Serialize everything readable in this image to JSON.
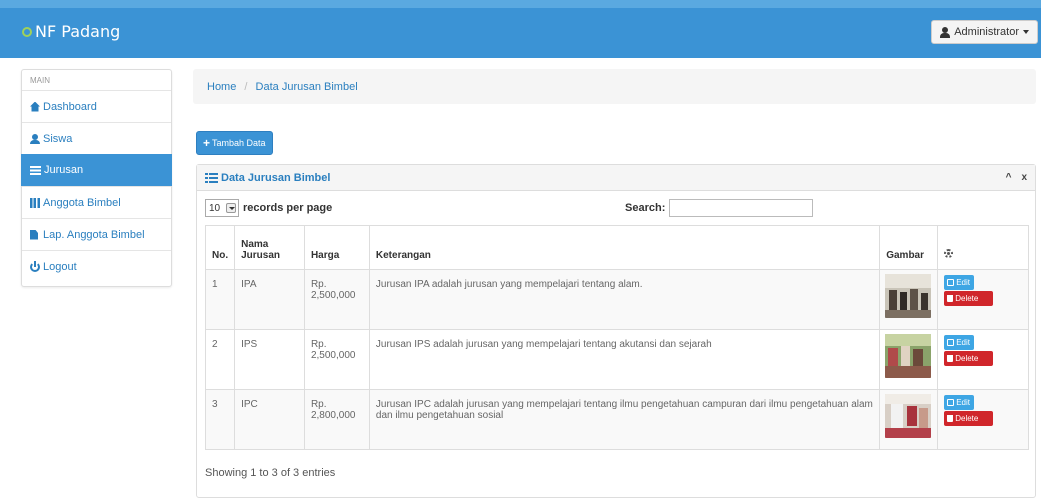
{
  "navbar": {
    "brand": "NF Padang",
    "user_label": "Administrator"
  },
  "sidebar": {
    "heading": "MAIN",
    "items": [
      {
        "label": "Dashboard",
        "icon": "home-icon"
      },
      {
        "label": "Siswa",
        "icon": "user-icon"
      },
      {
        "label": "Jurusan",
        "icon": "list-icon",
        "active": true
      },
      {
        "label": "Anggota Bimbel",
        "icon": "th-icon"
      },
      {
        "label": "Lap. Anggota Bimbel",
        "icon": "file-icon"
      },
      {
        "label": "Logout",
        "icon": "power-icon"
      }
    ]
  },
  "breadcrumb": {
    "home": "Home",
    "separator": "/",
    "current": "Data Jurusan Bimbel"
  },
  "add_button": "Tambah Data",
  "panel": {
    "title": "Data Jurusan Bimbel",
    "tools": [
      "^",
      "x"
    ]
  },
  "datatable": {
    "length_value": "10",
    "length_label": "records per page",
    "search_label": "Search:",
    "search_value": "",
    "columns": [
      "No.",
      "Nama Jurusan",
      "Harga",
      "Keterangan",
      "Gambar"
    ],
    "rows": [
      {
        "no": "1",
        "nama": "IPA",
        "harga": "Rp. 2,500,000",
        "keterangan": "Jurusan IPA adalah jurusan yang mempelajari tentang alam."
      },
      {
        "no": "2",
        "nama": "IPS",
        "harga": "Rp. 2,500,000",
        "keterangan": "Jurusan IPS adalah jurusan yang mempelajari tentang akutansi dan sejarah"
      },
      {
        "no": "3",
        "nama": "IPC",
        "harga": "Rp. 2,800,000",
        "keterangan": "Jurusan IPC adalah jurusan yang mempelajari tentang ilmu pengetahuan campuran dari ilmu pengetahuan alam dan ilmu pengetahuan sosial"
      }
    ],
    "edit_label": "Edit",
    "delete_label": "Delete",
    "info": "Showing 1 to 3 of 3 entries"
  },
  "colors": {
    "primary": "#3b93d5",
    "link": "#2a7fbf",
    "delete": "#d0262b",
    "edit": "#3ea6e4"
  }
}
